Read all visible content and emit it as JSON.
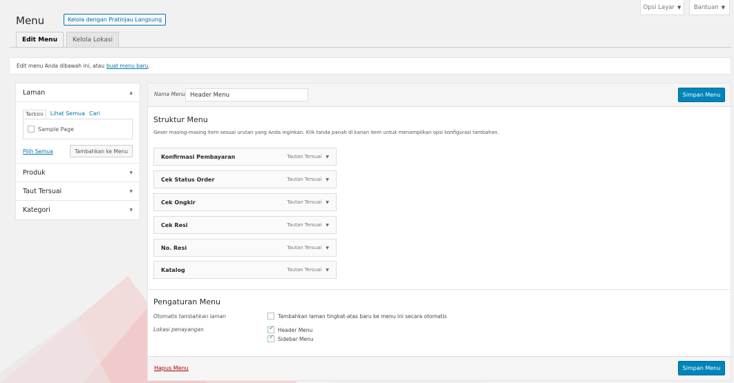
{
  "screen_options": {
    "label": "Opsi Layar",
    "help": "Bantuan"
  },
  "page": {
    "title": "Menu",
    "manage_live_preview": "Kelola dengan Pratinjau Langsung"
  },
  "tabs": [
    {
      "label": "Edit Menu"
    },
    {
      "label": "Kelola Lokasi"
    }
  ],
  "notice": {
    "text": "Edit menu Anda dibawah ini, atau",
    "link": "buat menu baru",
    "end": "."
  },
  "left_panel": {
    "sections": [
      {
        "title": "Laman"
      },
      {
        "title": "Produk"
      },
      {
        "title": "Taut Tersuai"
      },
      {
        "title": "Kategori"
      }
    ],
    "subtabs": [
      "Terkini",
      "Lihat Semua",
      "Cari"
    ],
    "items": [
      "Sample Page"
    ],
    "select_all": "Pilih Semua",
    "add_to_menu": "Tambahkan ke Menu"
  },
  "menu": {
    "name_label": "Nama Menu",
    "name_value": "Header Menu",
    "save_label": "Simpan Menu",
    "structure_title": "Struktur Menu",
    "structure_desc": "Geser masing-masing item sesuai urutan yang Anda inginkan. Klik tanda panah di kanan item untuk menampilkan opsi konfigurasi tambahan.",
    "items": [
      {
        "title": "Konfirmasi Pembayaran",
        "type": "Tautan Tersuai"
      },
      {
        "title": "Cek Status Order",
        "type": "Tautan Tersuai"
      },
      {
        "title": "Cek Ongkir",
        "type": "Tautan Tersuai"
      },
      {
        "title": "Cek Resi",
        "type": "Tautan Tersuai"
      },
      {
        "title": "No. Resi",
        "type": "Tautan Tersuai"
      },
      {
        "title": "Katalog",
        "type": "Tautan Tersuai"
      }
    ],
    "settings_title": "Pengaturan Menu",
    "auto_add_label": "Otomatis tambahkan laman",
    "auto_add_option": "Tambahkan laman tingkat-atas baru ke menu ini secara otomatis",
    "location_label": "Lokasi penayangan",
    "locations": [
      {
        "label": "Header Menu",
        "checked": true
      },
      {
        "label": "Sidebar Menu",
        "checked": true
      }
    ],
    "delete_label": "Hapus Menu"
  },
  "colors": {
    "accent": "#0085ba",
    "link": "#0073aa",
    "delete": "#a00000"
  },
  "icons": {
    "dropdown": "triangle-down-icon",
    "collapse": "triangle-up-icon"
  }
}
